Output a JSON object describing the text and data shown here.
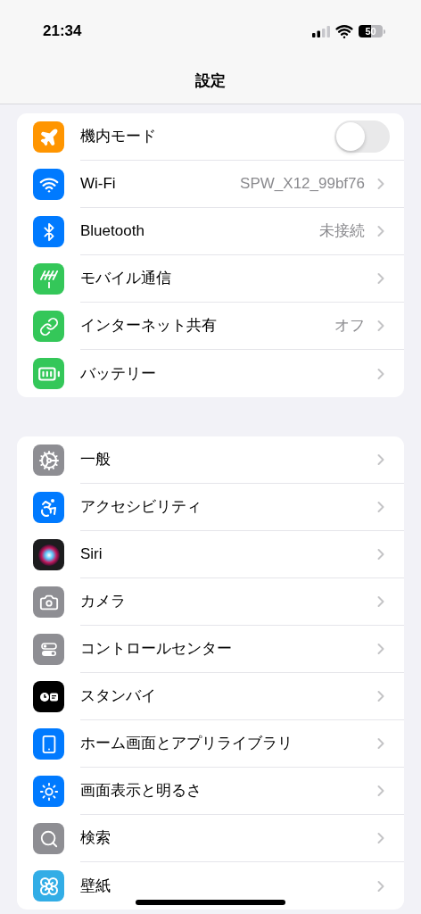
{
  "status_bar": {
    "time": "21:34",
    "battery": "50"
  },
  "navigation_bar": {
    "title": "設定"
  },
  "groups": [
    {
      "items": [
        {
          "kind": "toggle",
          "label": "機内モード",
          "on": false
        },
        {
          "kind": "link",
          "label": "Wi-Fi",
          "value": "SPW_X12_99bf76"
        },
        {
          "kind": "link",
          "label": "Bluetooth",
          "value": "未接続"
        },
        {
          "kind": "link",
          "label": "モバイル通信"
        },
        {
          "kind": "link",
          "label": "インターネット共有",
          "value": "オフ"
        },
        {
          "kind": "link",
          "label": "バッテリー"
        }
      ]
    },
    {
      "items": [
        {
          "kind": "link",
          "label": "一般"
        },
        {
          "kind": "link",
          "label": "アクセシビリティ"
        },
        {
          "kind": "link",
          "label": "Siri"
        },
        {
          "kind": "link",
          "label": "カメラ"
        },
        {
          "kind": "link",
          "label": "コントロールセンター"
        },
        {
          "kind": "link",
          "label": "スタンバイ"
        },
        {
          "kind": "link",
          "label": "ホーム画面とアプリライブラリ"
        },
        {
          "kind": "link",
          "label": "画面表示と明るさ"
        },
        {
          "kind": "link",
          "label": "検索"
        },
        {
          "kind": "link",
          "label": "壁紙"
        }
      ]
    }
  ]
}
